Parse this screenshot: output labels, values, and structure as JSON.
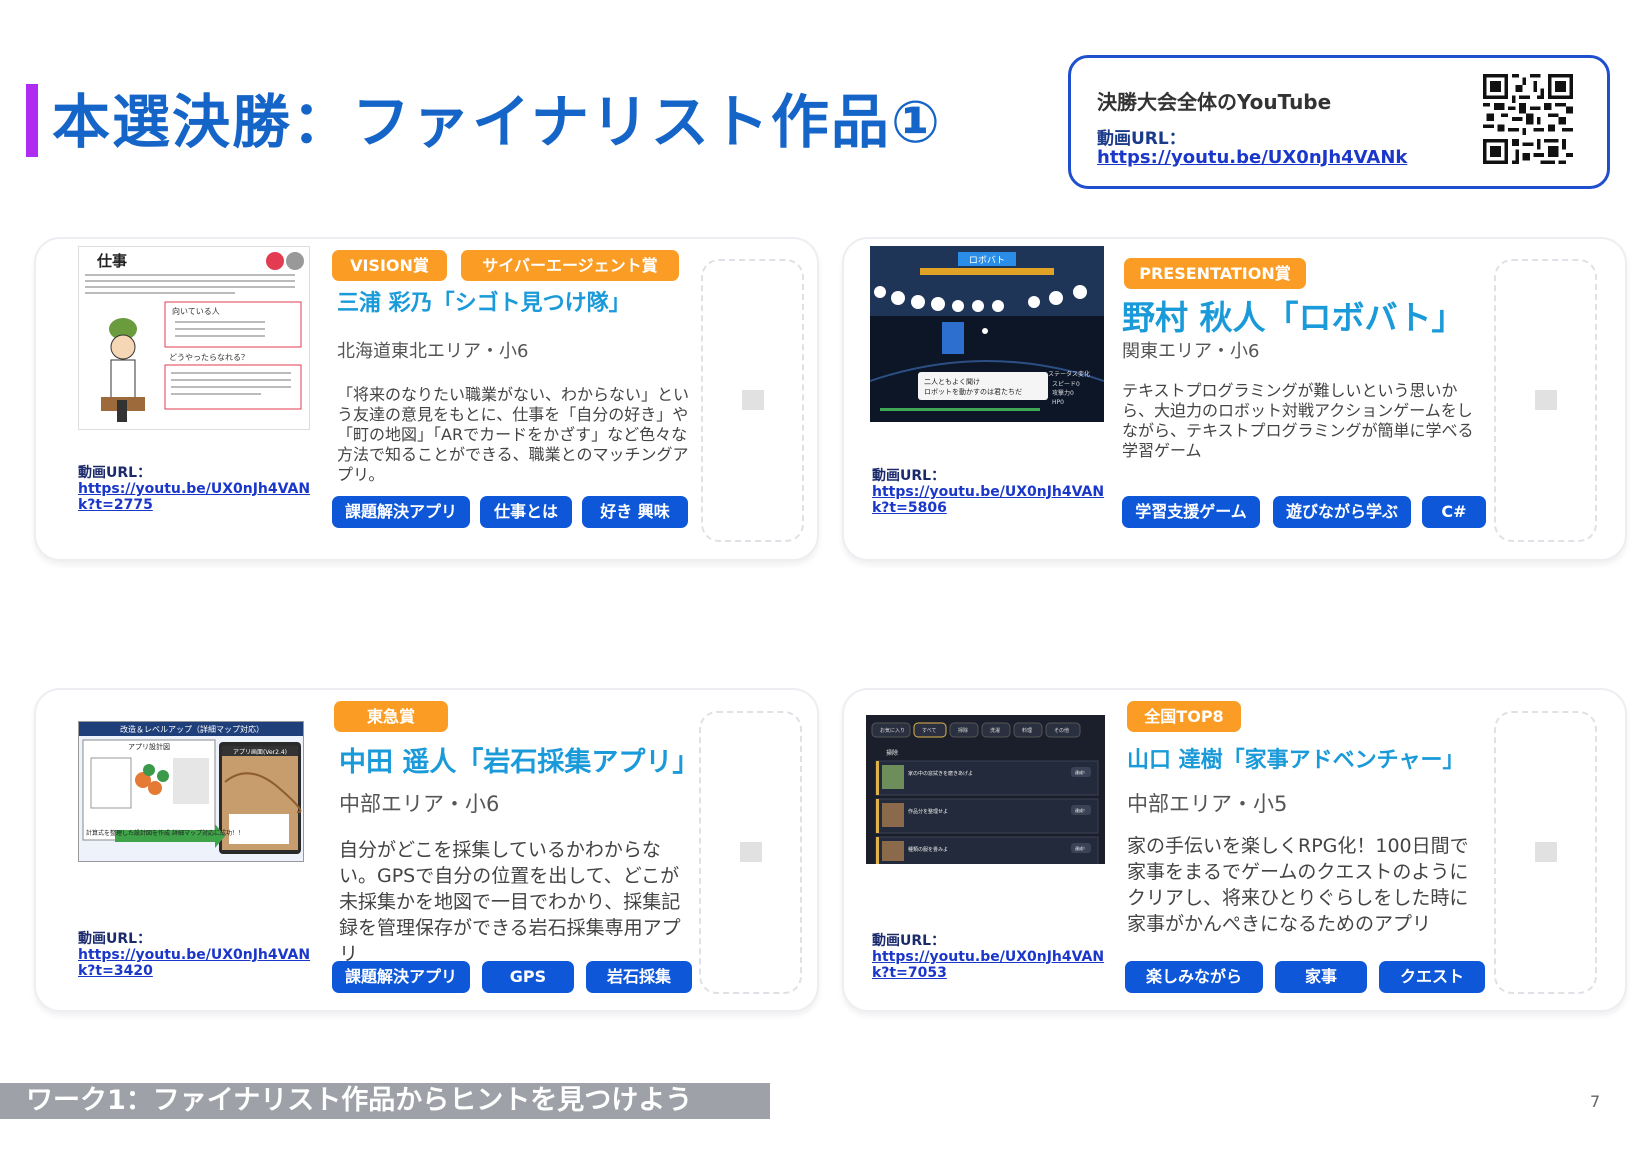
{
  "header": {
    "title": "本選決勝：ファイナリスト作品①"
  },
  "youtube_box": {
    "title": "決勝大会全体のYouTube",
    "url_label": "動画URL：",
    "url": "https://youtu.be/UX0nJh4VANk"
  },
  "cards": [
    {
      "badges": [
        "VISION賞",
        "サイバーエージェント賞"
      ],
      "name": "三浦 彩乃「シゴト見つけ隊」",
      "area": "北海道東北エリア・小6",
      "description": "「将来のなりたい職業がない、わからない」という友達の意見をもとに、仕事を「自分の好き」や「町の地図」「ARでカードをかざす」など色々な方法で知ることができる、職業とのマッチングアプリ。",
      "tags": [
        "課題解決アプリ",
        "仕事とは",
        "好き 興味"
      ],
      "url_label": "動画URL：",
      "url": "https://youtu.be/UX0nJh4VANk?t=2775"
    },
    {
      "badges": [
        "PRESENTATION賞"
      ],
      "name": "野村 秋人「ロボバト」",
      "area": "関東エリア・小6",
      "description": "テキストプログラミングが難しいという思いから、大迫力のロボット対戦アクションゲームをしながら、テキストプログラミングが簡単に学べる学習ゲーム",
      "tags": [
        "学習支援ゲーム",
        "遊びながら学ぶ",
        "C#"
      ],
      "url_label": "動画URL：",
      "url": "https://youtu.be/UX0nJh4VANk?t=5806"
    },
    {
      "badges": [
        "東急賞"
      ],
      "name": "中田 遥人「岩石採集アプリ」",
      "area": "中部エリア・小6",
      "description": "自分がどこを採集しているかわからない。GPSで自分の位置を出して、どこが未採集かを地図で一目でわかり、採集記録を管理保存ができる岩石採集専用アプリ",
      "tags": [
        "課題解決アプリ",
        "GPS",
        "岩石採集"
      ],
      "url_label": "動画URL：",
      "url": "https://youtu.be/UX0nJh4VANk?t=3420"
    },
    {
      "badges": [
        "全国TOP8"
      ],
      "name": "山口 達樹「家事アドベンチャー」",
      "area": "中部エリア・小5",
      "description": "家の手伝いを楽しくRPG化！100日間で家事をまるでゲームのクエストのようにクリアし、将来ひとりぐらしをした時に家事がかんぺきになるためのアプリ",
      "tags": [
        "楽しみながら",
        "家事",
        "クエスト"
      ],
      "url_label": "動画URL：",
      "url": "https://youtu.be/UX0nJh4VANk?t=7053"
    }
  ],
  "thumbnails": {
    "card1": {
      "heading": "仕事",
      "subheads": [
        "向いている人",
        "どうやったらなれる？"
      ]
    },
    "card2": {
      "banner": "ロボバト",
      "dialog": [
        "二人ともよく聞け",
        "ロボットを動かすのは君たちだ"
      ],
      "stats": [
        "ステータス変化",
        "スピード0",
        "攻撃力0",
        "HP0"
      ]
    },
    "card3": {
      "header": "改造＆レベルアップ（詳細マップ対応）",
      "left_label": "アプリ設計図",
      "right_label": "アプリ画面(Ver2.4)",
      "caption": "計算式を整理した設計図を作成 詳細マップ対応に成功！！"
    },
    "card4": {
      "tabs": [
        "お気に入り",
        "すべて",
        "掃除",
        "洗濯",
        "料理",
        "その他"
      ],
      "section": "掃除",
      "quests": [
        "家の中の窓拭きを磨きあげよ",
        "作品分を整理せよ",
        "種類の服を畳みよ"
      ],
      "buttons": [
        "達成！",
        "達成！",
        "達成！"
      ]
    }
  },
  "footer": {
    "text": "ワーク1：ファイナリスト作品からヒントを見つけよう",
    "page": "7"
  },
  "colors": {
    "title": "#1565c8",
    "accent_bar": "#b12cf2",
    "name": "#1a9ad9",
    "badge": "#fb9d24",
    "tag": "#0d57d8",
    "link": "#1a37c9",
    "yt_border": "#1d4fcf",
    "footer_bar": "#9ea1a7"
  }
}
